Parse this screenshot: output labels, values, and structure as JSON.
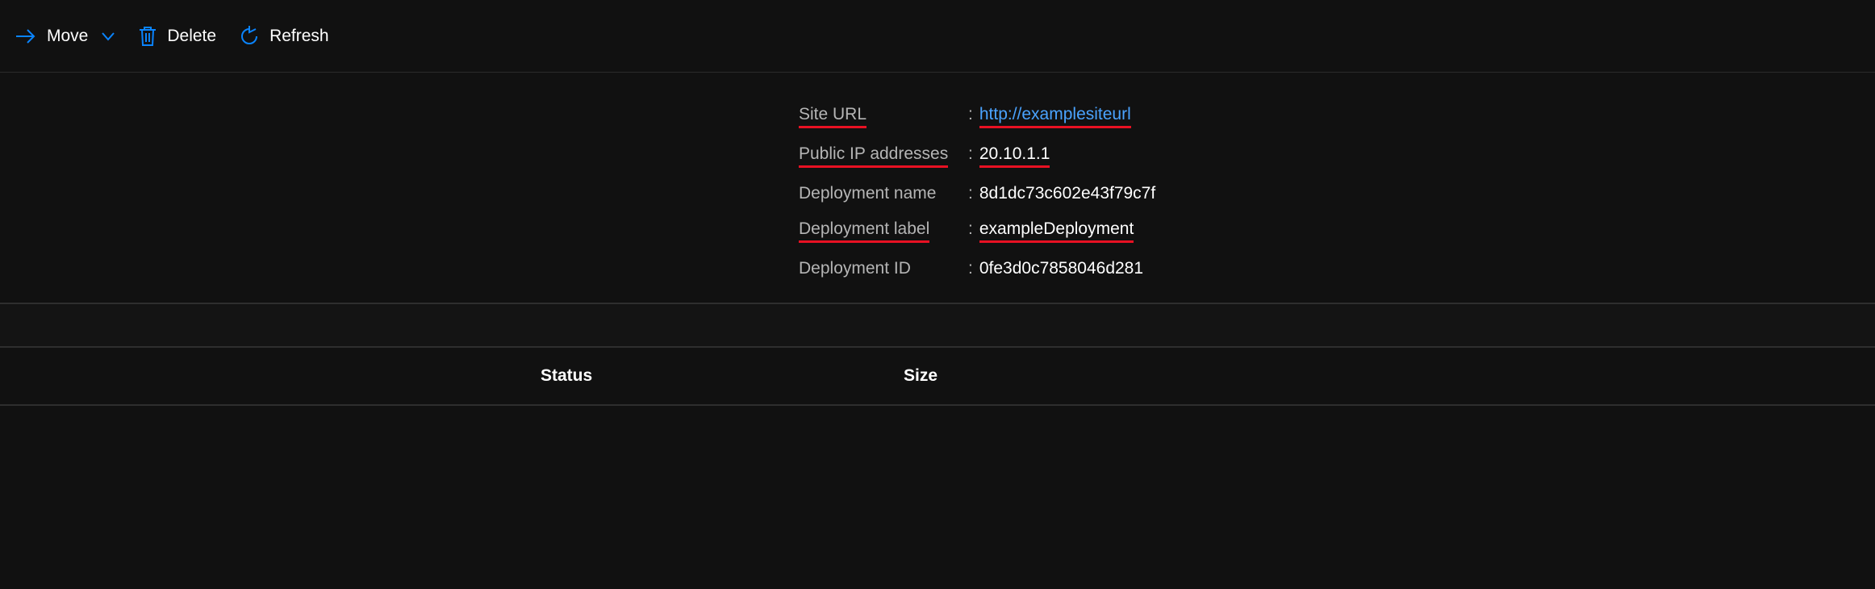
{
  "toolbar": {
    "move_label": "Move",
    "delete_label": "Delete",
    "refresh_label": "Refresh"
  },
  "details": {
    "site_url_label": "Site URL",
    "site_url_value": "http://examplesiteurl",
    "public_ip_label": "Public IP addresses",
    "public_ip_value": "20.10.1.1",
    "deployment_name_label": "Deployment name",
    "deployment_name_value": "8d1dc73c602e43f79c7f",
    "deployment_label_label": "Deployment label",
    "deployment_label_value": "exampleDeployment",
    "deployment_id_label": "Deployment ID",
    "deployment_id_value": "0fe3d0c7858046d281"
  },
  "table": {
    "status_header": "Status",
    "size_header": "Size"
  }
}
